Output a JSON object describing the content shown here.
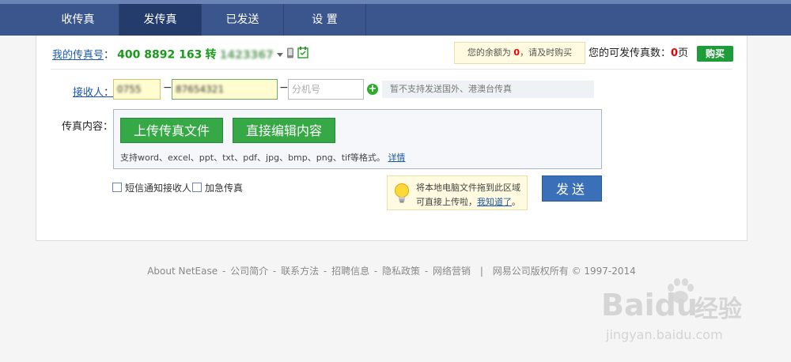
{
  "nav": {
    "tabs": [
      {
        "label": "收传真"
      },
      {
        "label": "发传真"
      },
      {
        "label": "已发送"
      },
      {
        "label": "设 置"
      }
    ]
  },
  "faxinfo": {
    "label": "我的传真号",
    "colon": "：",
    "number": "400 8892 163",
    "ext_label": "转",
    "ext_value": "1423367"
  },
  "balance": {
    "prefix": "您的余额为 ",
    "amount": "0",
    "suffix": "，请及时购买"
  },
  "available": {
    "label": "您的可发传真数：",
    "count": "0",
    "unit": "页"
  },
  "buy_label": "购买",
  "recipient": {
    "label": "接收人",
    "colon": "：",
    "area_code": "0755",
    "number": "87654321",
    "ext_placeholder": "分机号",
    "dash": "−",
    "notice": "暂不支持发送国外、港澳台传真"
  },
  "content": {
    "label": "传真内容：",
    "upload_label": "上传传真文件",
    "edit_label": "直接编辑内容",
    "support_text": "支持word、excel、ppt、txt、pdf、jpg、bmp、png、tif等格式。",
    "detail_link": "详情"
  },
  "options": {
    "sms_notify": "短信通知接收人",
    "urgent": "加急传真"
  },
  "drag_tip": {
    "line1": "将本地电脑文件拖到此区域",
    "line2": "可直接上传啦，",
    "link": "我知道了",
    "end": "。"
  },
  "send_label": "发送",
  "footer": {
    "links": [
      "About NetEase",
      "公司简介",
      "联系方法",
      "招聘信息",
      "隐私政策",
      "网络营销"
    ],
    "sep": " - ",
    "bar": "|",
    "copyright": "网易公司版权所有 © 1997-2014"
  },
  "watermark": {
    "brand": "Bai",
    "brand2": "du",
    "cn": "经验",
    "url": "jingyan.baidu.com"
  }
}
